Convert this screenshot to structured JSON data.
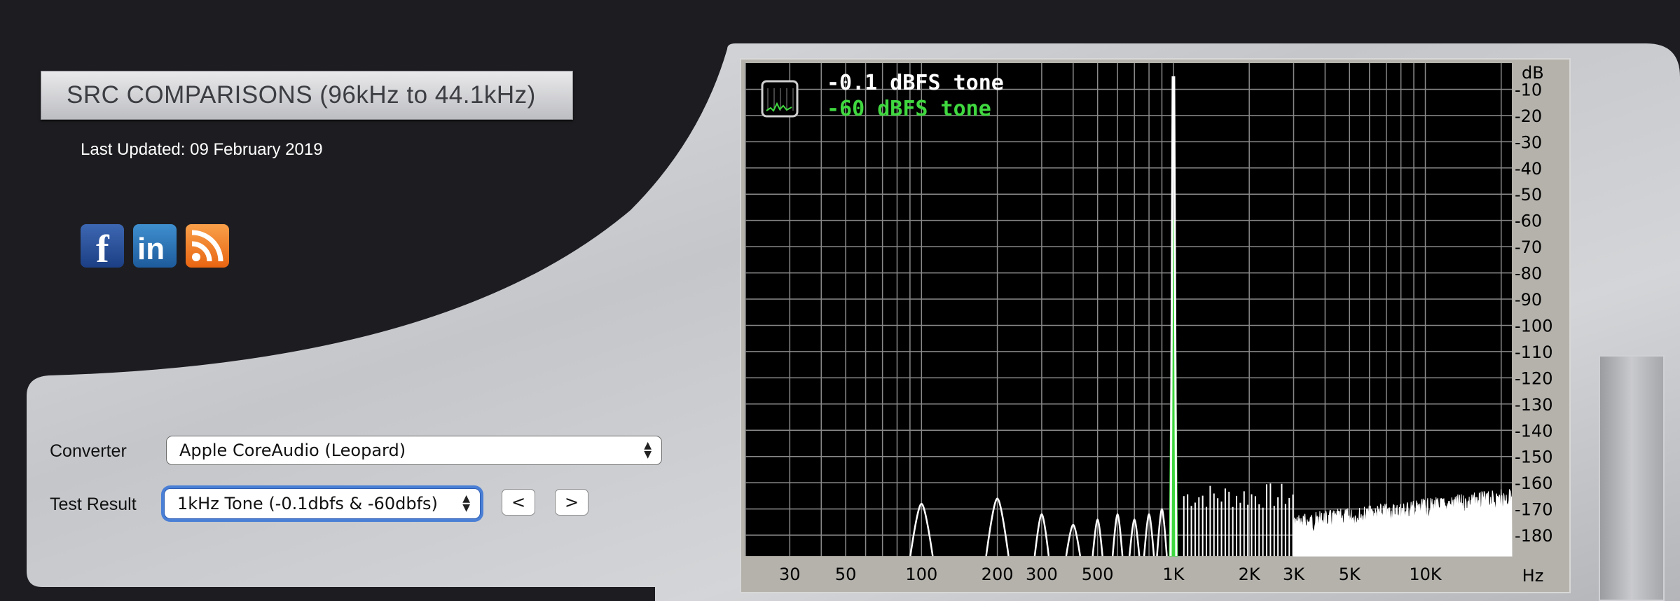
{
  "header": {
    "title": "SRC COMPARISONS (96kHz to 44.1kHz)",
    "last_updated": "Last Updated: 09 February 2019"
  },
  "social": [
    {
      "name": "facebook-icon",
      "glyph": "f",
      "color": "#2b5298"
    },
    {
      "name": "linkedin-icon",
      "glyph": "in",
      "color": "#2b75b8"
    },
    {
      "name": "rss-icon",
      "glyph": "rss",
      "color": "#f07d22"
    }
  ],
  "form": {
    "converter_label": "Converter",
    "converter_value": "Apple CoreAudio (Leopard)",
    "test_label": "Test Result",
    "test_value": "1kHz Tone (-0.1dbfs & -60dbfs)",
    "prev_label": "<",
    "next_label": ">"
  },
  "chart_data": {
    "type": "line",
    "legend": [
      {
        "name": "-0.1 dBFS tone",
        "color": "#ffffff"
      },
      {
        "name": "-60 dBFS tone",
        "color": "#3fd83f"
      }
    ],
    "x_scale": "log",
    "x_unit": "Hz",
    "xlim": [
      20,
      22050
    ],
    "x_ticks": [
      {
        "value": 30,
        "label": "30"
      },
      {
        "value": 50,
        "label": "50"
      },
      {
        "value": 100,
        "label": "100"
      },
      {
        "value": 200,
        "label": "200"
      },
      {
        "value": 300,
        "label": "300"
      },
      {
        "value": 500,
        "label": "500"
      },
      {
        "value": 1000,
        "label": "1K"
      },
      {
        "value": 2000,
        "label": "2K"
      },
      {
        "value": 3000,
        "label": "3K"
      },
      {
        "value": 5000,
        "label": "5K"
      },
      {
        "value": 10000,
        "label": "10K"
      }
    ],
    "y_unit": "dB",
    "ylim": [
      -188,
      0
    ],
    "y_ticks": [
      -10,
      -20,
      -30,
      -40,
      -50,
      -60,
      -70,
      -80,
      -90,
      -100,
      -110,
      -120,
      -130,
      -140,
      -150,
      -160,
      -170,
      -180
    ],
    "series": [
      {
        "name": "-0.1 dBFS tone",
        "color": "#ffffff",
        "fundamental": {
          "freq": 1000,
          "level": -0.1
        },
        "harmonics": [
          {
            "freq": 100,
            "level": -168
          },
          {
            "freq": 200,
            "level": -166
          },
          {
            "freq": 300,
            "level": -172
          },
          {
            "freq": 400,
            "level": -176
          },
          {
            "freq": 500,
            "level": -174
          },
          {
            "freq": 600,
            "level": -172
          },
          {
            "freq": 700,
            "level": -174
          },
          {
            "freq": 800,
            "level": -172
          },
          {
            "freq": 900,
            "level": -170
          }
        ],
        "noise_floor_high": {
          "from": 3000,
          "to": 22050,
          "level_from": -172,
          "level_to": -162
        }
      },
      {
        "name": "-60 dBFS tone",
        "color": "#3fd83f",
        "fundamental": {
          "freq": 1000,
          "level": -60
        }
      }
    ]
  }
}
